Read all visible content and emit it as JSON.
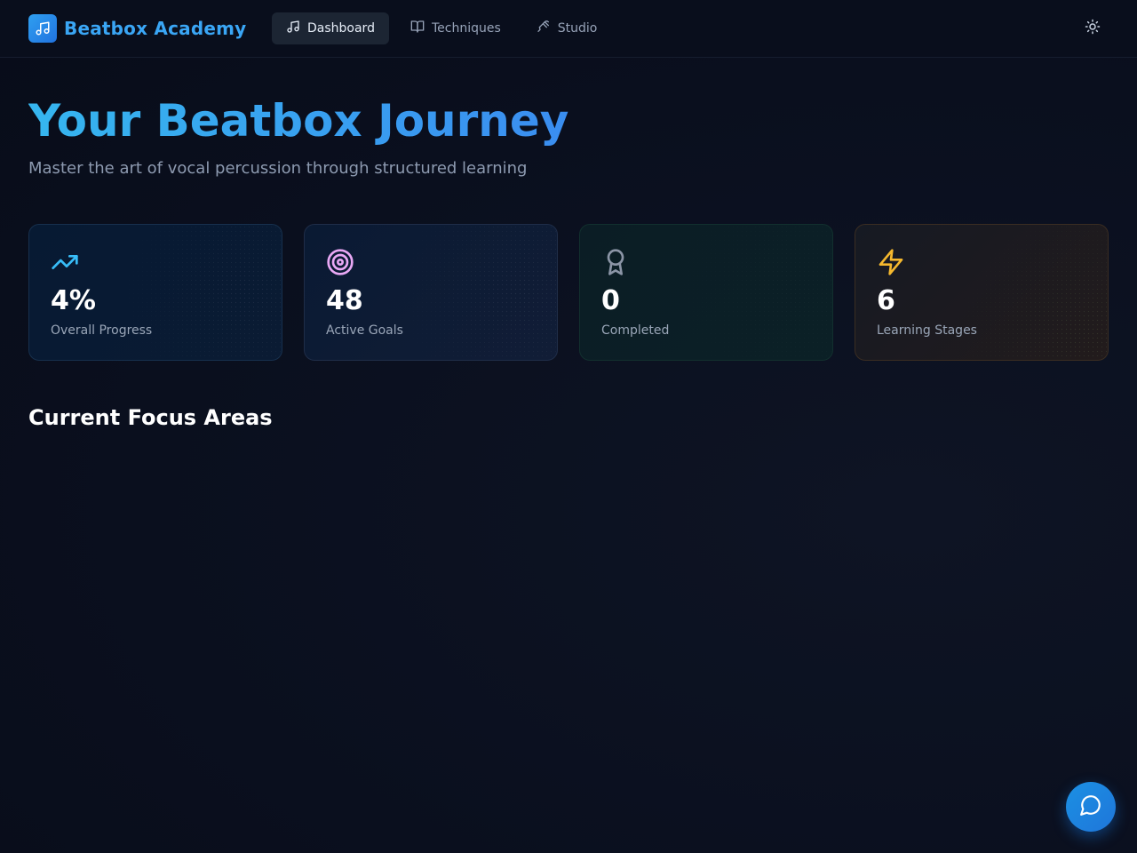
{
  "app": {
    "brand_name": "Beatbox Academy",
    "brand_icon": "music-note-icon"
  },
  "nav": {
    "items": [
      {
        "label": "Dashboard",
        "icon": "music-note-icon",
        "active": true
      },
      {
        "label": "Techniques",
        "icon": "book-open-icon",
        "active": false
      },
      {
        "label": "Studio",
        "icon": "microphone-icon",
        "active": false
      }
    ],
    "theme_toggle_icon": "sun-icon"
  },
  "hero": {
    "title": "Your Beatbox Journey",
    "subtitle": "Master the art of vocal percussion through structured learning"
  },
  "stats": [
    {
      "value": "4%",
      "label": "Overall Progress",
      "icon": "trending-up-icon",
      "color": "#38bdf8"
    },
    {
      "value": "48",
      "label": "Active Goals",
      "icon": "target-icon",
      "color": "#e9a8f5"
    },
    {
      "value": "0",
      "label": "Completed",
      "icon": "award-icon",
      "color": "#8b95a6"
    },
    {
      "value": "6",
      "label": "Learning Stages",
      "icon": "zap-icon",
      "color": "#f5b82e"
    }
  ],
  "focus": {
    "title": "Current Focus Areas"
  },
  "chat": {
    "icon": "chat-bubble-icon"
  },
  "colors": {
    "accent": "#3aa6f5",
    "background": "#0a0f1e"
  }
}
